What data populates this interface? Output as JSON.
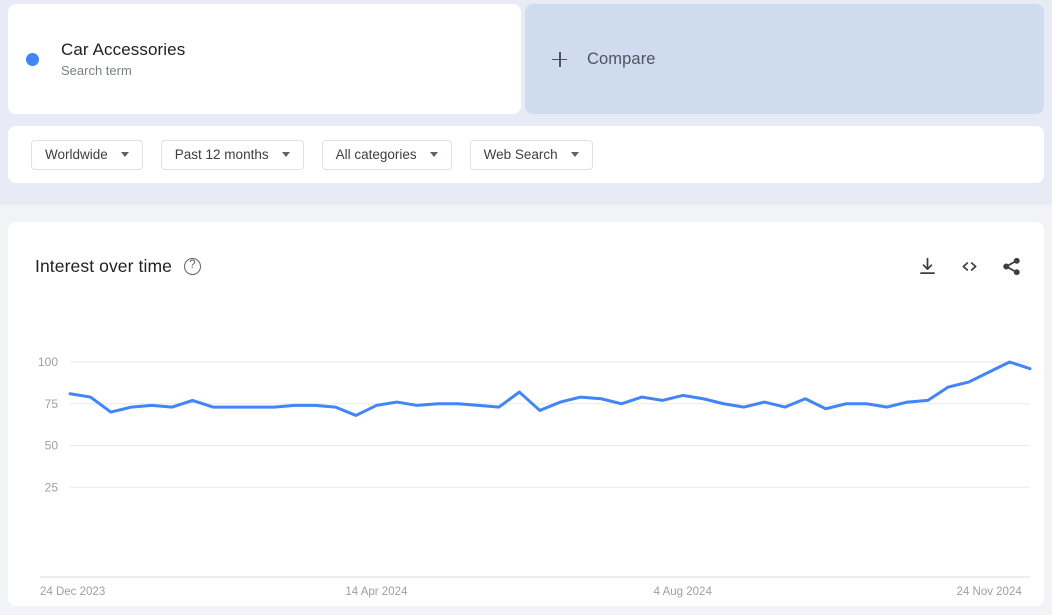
{
  "search_term": {
    "name": "Car Accessories",
    "type_label": "Search term",
    "dot_color": "#4285f4"
  },
  "compare": {
    "label": "Compare",
    "icon": "plus-icon"
  },
  "filters": [
    {
      "label": "Worldwide",
      "name": "location-filter"
    },
    {
      "label": "Past 12 months",
      "name": "time-range-filter"
    },
    {
      "label": "All categories",
      "name": "category-filter"
    },
    {
      "label": "Web Search",
      "name": "search-type-filter"
    }
  ],
  "chart_card": {
    "title": "Interest over time",
    "help_glyph": "?",
    "actions": [
      {
        "name": "download-icon"
      },
      {
        "name": "embed-code-icon"
      },
      {
        "name": "share-icon"
      }
    ]
  },
  "chart_data": {
    "type": "line",
    "title": "Interest over time",
    "xlabel": "",
    "ylabel": "",
    "ylim": [
      0,
      100
    ],
    "yticks": [
      25,
      50,
      75,
      100
    ],
    "grid": true,
    "legend_position": "top",
    "line_color": "#4285f4",
    "x_tick_labels": [
      "24 Dec 2023",
      "14 Apr 2024",
      "4 Aug 2024",
      "24 Nov 2024"
    ],
    "x_tick_positions": [
      0,
      15,
      30,
      45
    ],
    "series": [
      {
        "name": "Car Accessories",
        "values": [
          81,
          79,
          70,
          73,
          74,
          73,
          77,
          73,
          73,
          73,
          73,
          74,
          74,
          73,
          68,
          74,
          76,
          74,
          75,
          75,
          74,
          73,
          82,
          71,
          76,
          79,
          78,
          75,
          79,
          77,
          80,
          78,
          75,
          73,
          76,
          73,
          78,
          72,
          75,
          75,
          73,
          76,
          77,
          85,
          88,
          94,
          100,
          96
        ]
      }
    ]
  }
}
